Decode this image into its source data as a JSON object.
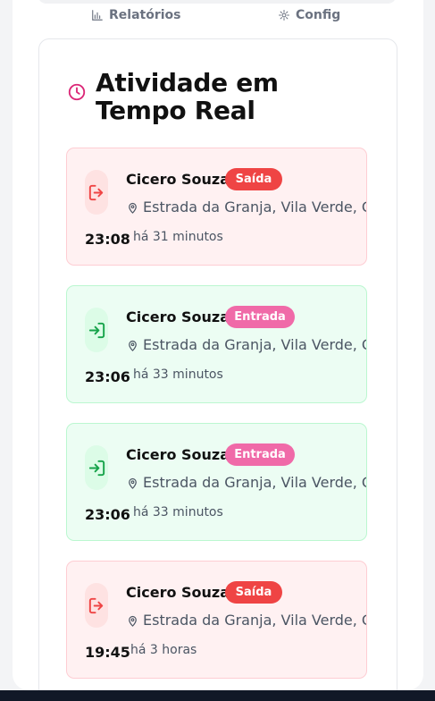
{
  "tabs": {
    "reports_label": "Relatórios",
    "config_label": "Config"
  },
  "activity": {
    "title": "Atividade em Tempo Real",
    "items": [
      {
        "name": "Cicero Souza",
        "badge": "Saída",
        "location": "Estrada da Granja, Vila Verde, Gondomar (S",
        "time": "23:08",
        "ago": "há 31 minutos",
        "type": "exit"
      },
      {
        "name": "Cicero Souza",
        "badge": "Entrada",
        "location": "Estrada da Granja, Vila Verde, Gondomar (S",
        "time": "23:06",
        "ago": "há 33 minutos",
        "type": "entry"
      },
      {
        "name": "Cicero Souza",
        "badge": "Entrada",
        "location": "Estrada da Granja, Vila Verde, Gondomar (S",
        "time": "23:06",
        "ago": "há 33 minutos",
        "type": "entry"
      },
      {
        "name": "Cicero Souza",
        "badge": "Saída",
        "location": "Estrada da Granja, Vila Verde, Gondomar (S",
        "time": "19:45",
        "ago": "há 3 horas",
        "type": "exit"
      }
    ]
  },
  "icons": {
    "reports": "bar-chart-icon",
    "config": "gear-icon",
    "activity": "clock-icon",
    "exit": "logout-icon",
    "entry": "login-icon",
    "location": "map-pin-icon"
  },
  "colors": {
    "exit_badge": "#ef4444",
    "entry_badge": "#f06aa8",
    "exit_background": "#fff1f2",
    "entry_background": "#ecfdf3",
    "activity_icon": "#db2777"
  }
}
